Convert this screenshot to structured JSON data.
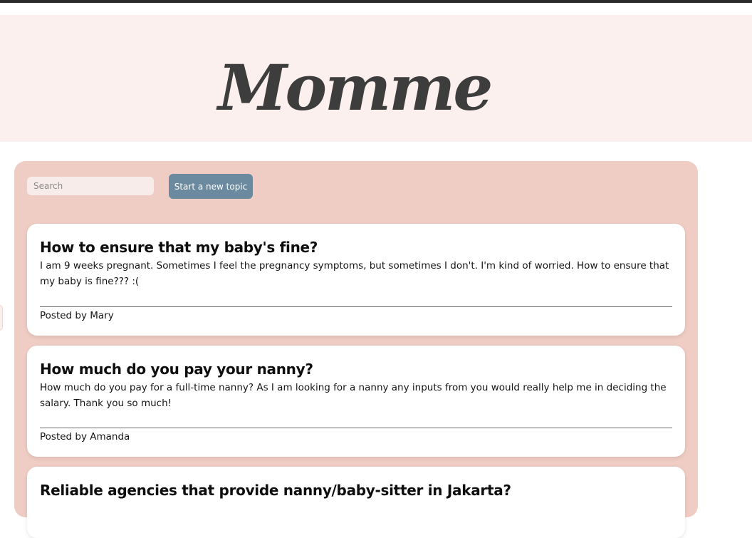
{
  "header": {
    "logo_text": "Momme"
  },
  "toolbar": {
    "search_placeholder": "Search",
    "new_topic_label": "Start a new topic"
  },
  "topics": [
    {
      "title": "How to ensure that my baby's fine?",
      "body": "I am 9 weeks pregnant. Sometimes I feel the pregnancy symptoms, but sometimes I don't. I'm kind of worried. How to ensure that my baby is fine??? :(",
      "author_line": "Posted by Mary"
    },
    {
      "title": "How much do you pay your nanny?",
      "body": "How much do you pay for a full-time nanny? As I am looking for a nanny any inputs from you would really help me in deciding the salary. Thank you so much!",
      "author_line": "Posted by Amanda"
    },
    {
      "title": "Reliable agencies that provide nanny/baby-sitter in Jakarta?",
      "body": "",
      "author_line": ""
    }
  ],
  "colors": {
    "header_bg": "#fbf0ee",
    "panel_bg": "#efcdc4",
    "button_bg": "#6b8a9f",
    "logo": "#3d3d3d"
  }
}
